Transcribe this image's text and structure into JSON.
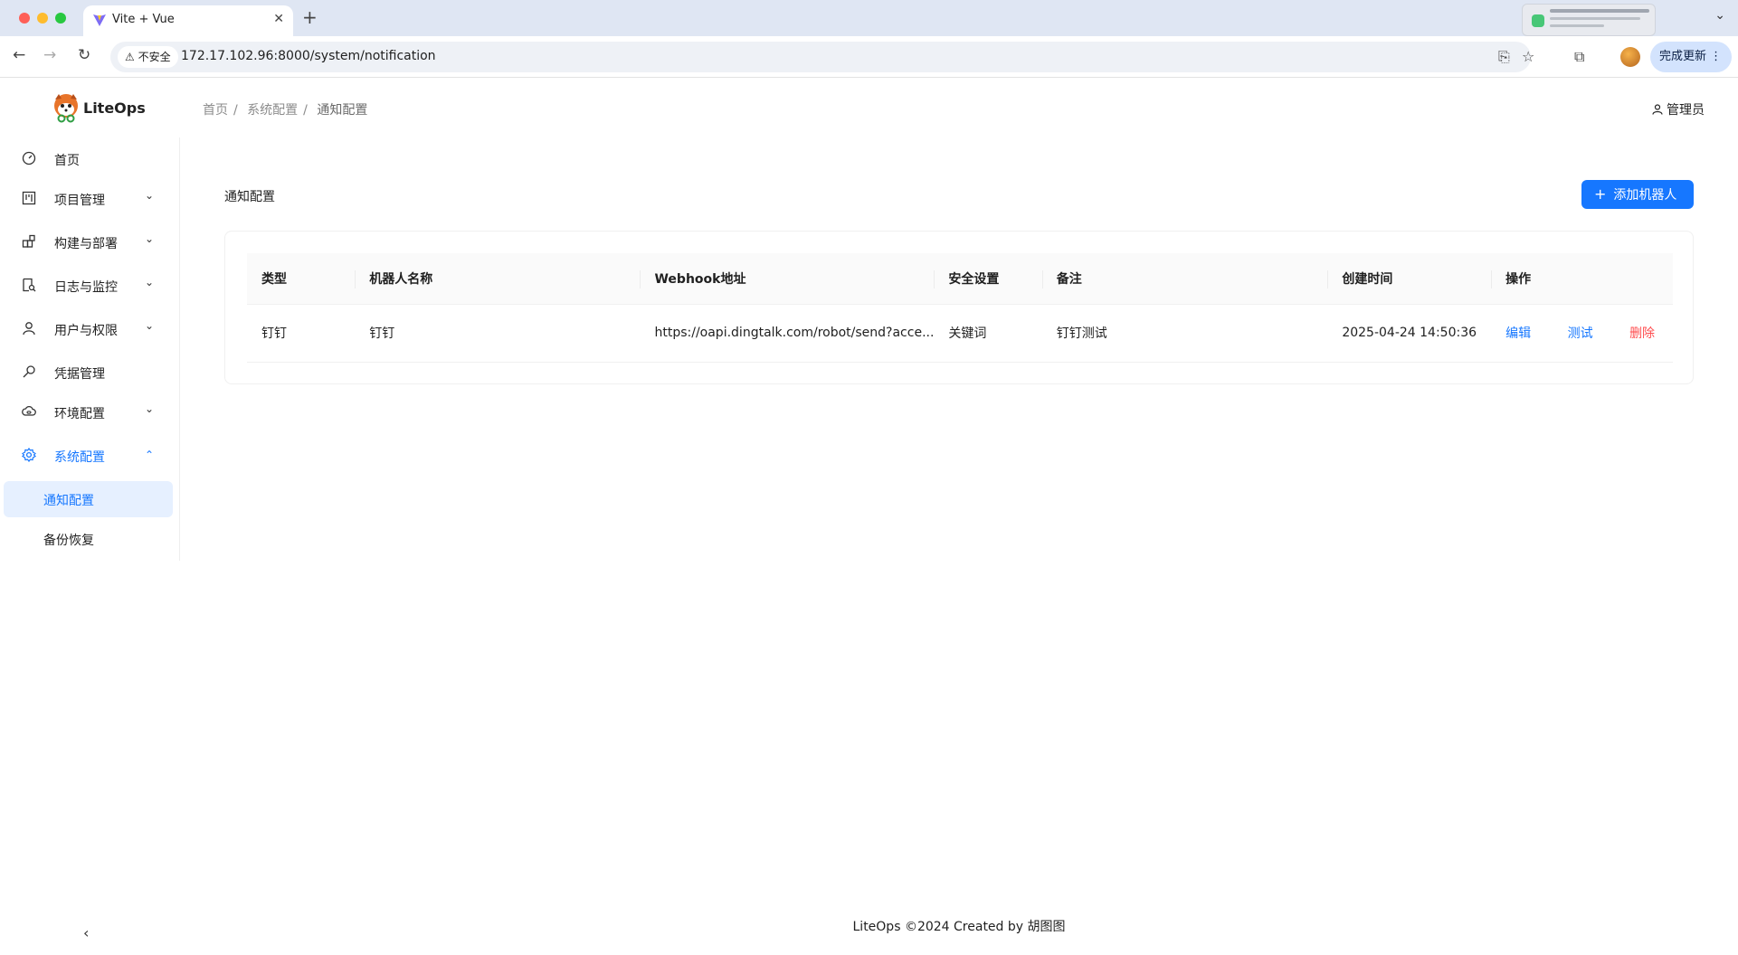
{
  "browser": {
    "tab_title": "Vite + Vue",
    "insecure_label": "不安全",
    "url": "172.17.102.96:8000/system/notification",
    "update_label": "完成更新"
  },
  "app": {
    "logo_text": "LiteOps",
    "breadcrumb": [
      "首页",
      "系统配置",
      "通知配置"
    ],
    "user": "管理员"
  },
  "sidebar": {
    "items": [
      {
        "label": "首页",
        "icon": "dashboard-icon"
      },
      {
        "label": "项目管理",
        "icon": "project-icon"
      },
      {
        "label": "构建与部署",
        "icon": "build-icon"
      },
      {
        "label": "日志与监控",
        "icon": "log-icon"
      },
      {
        "label": "用户与权限",
        "icon": "user-icon"
      },
      {
        "label": "凭据管理",
        "icon": "key-icon"
      },
      {
        "label": "环境配置",
        "icon": "cloud-icon"
      },
      {
        "label": "系统配置",
        "icon": "gear-icon"
      }
    ],
    "subitems": [
      {
        "label": "通知配置"
      },
      {
        "label": "备份恢复"
      }
    ]
  },
  "main": {
    "title": "通知配置",
    "add_button": "添加机器人",
    "table": {
      "headers": [
        "类型",
        "机器人名称",
        "Webhook地址",
        "安全设置",
        "备注",
        "创建时间",
        "操作"
      ],
      "rows": [
        {
          "type": "钉钉",
          "name": "钉钉",
          "webhook": "https://oapi.dingtalk.com/robot/send?acce...",
          "security": "关键词",
          "remark": "钉钉测试",
          "created": "2025-04-24 14:50:36",
          "actions": [
            "编辑",
            "测试",
            "删除"
          ]
        }
      ]
    }
  },
  "footer": "LiteOps ©2024 Created by 胡图图",
  "colors": {
    "primary": "#1677ff",
    "danger": "#ff4d4f"
  }
}
